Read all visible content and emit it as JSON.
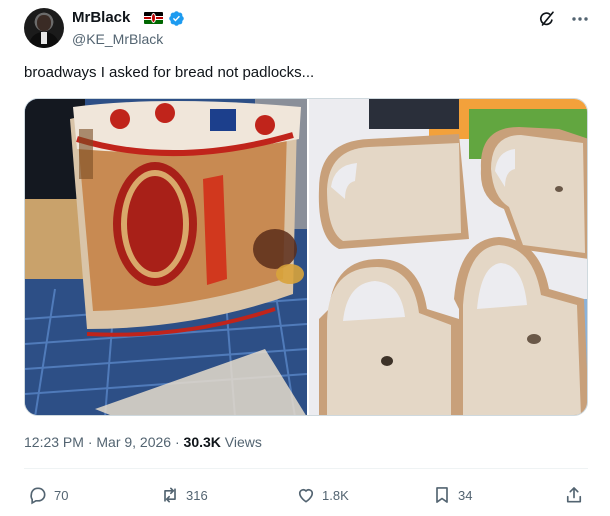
{
  "author": {
    "display_name": "MrBlack",
    "handle": "@KE_MrBlack",
    "flag_icon": "kenya-flag-icon",
    "verified_icon": "verified-badge-icon",
    "verified_color": "#1d9bf0"
  },
  "post": {
    "text": "broadways I asked for bread not padlocks...",
    "timestamp": "12:23 PM · Mar 9, 2026 · ",
    "views_count": "30.3K",
    "views_label": " Views"
  },
  "media": {
    "left_photo_icon": "bread-bag-photo",
    "right_photo_icon": "padlock-shaped-bread-photo"
  },
  "actions": {
    "replies": "70",
    "reposts": "316",
    "likes": "1.8K",
    "bookmarks": "34"
  },
  "colors": {
    "text_primary": "#0f1419",
    "text_secondary": "#536471",
    "accent": "#1d9bf0",
    "divider": "#eff3f4"
  }
}
